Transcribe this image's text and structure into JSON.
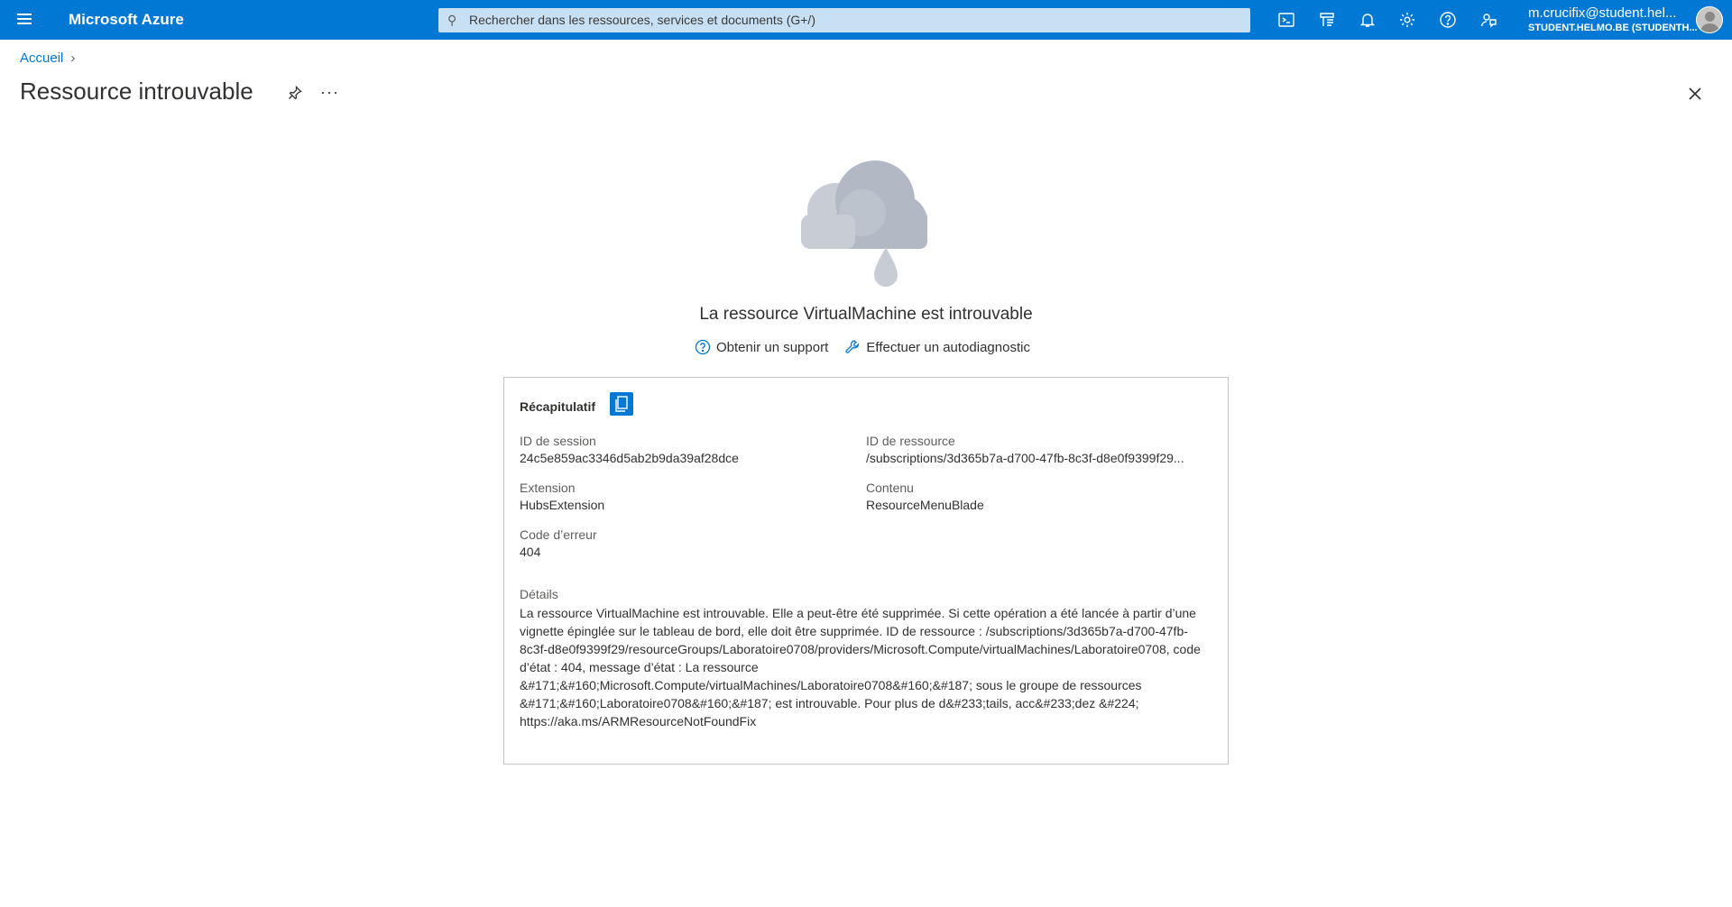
{
  "topbar": {
    "brand": "Microsoft Azure",
    "search_placeholder": "Rechercher dans les ressources, services et documents (G+/)",
    "account_name": "m.crucifix@student.hel...",
    "account_tenant": "STUDENT.HELMO.BE (STUDENTH...",
    "icons": [
      "cloud-shell-icon",
      "directory-filter-icon",
      "notifications-icon",
      "settings-icon",
      "help-icon",
      "feedback-icon"
    ]
  },
  "breadcrumb": {
    "home": "Accueil"
  },
  "page": {
    "title": "Ressource introuvable"
  },
  "error": {
    "title": "La ressource VirtualMachine est introuvable",
    "support_link": "Obtenir un support",
    "diagnose_link": "Effectuer un autodiagnostic"
  },
  "summary": {
    "heading": "Récapitulatif",
    "session_label": "ID de session",
    "session_value": "24c5e859ac3346d5ab2b9da39af28dce",
    "resource_label": "ID de ressource",
    "resource_value": "/subscriptions/3d365b7a-d700-47fb-8c3f-d8e0f9399f29...",
    "extension_label": "Extension",
    "extension_value": "HubsExtension",
    "content_label": "Contenu",
    "content_value": "ResourceMenuBlade",
    "code_label": "Code d’erreur",
    "code_value": "404",
    "details_label": "Détails",
    "details_value": "La ressource VirtualMachine est introuvable. Elle a peut-être été supprimée. Si cette opération a été lancée à partir d’une vignette épinglée sur le tableau de bord, elle doit être supprimée. ID de ressource : /subscriptions/3d365b7a-d700-47fb-8c3f-d8e0f9399f29/resourceGroups/Laboratoire0708/providers/Microsoft.Compute/virtualMachines/Laboratoire0708, code d’état : 404, message d’état : La ressource &#171;&#160;Microsoft.Compute/virtualMachines/Laboratoire0708&#160;&#187; sous le groupe de ressources &#171;&#160;Laboratoire0708&#160;&#187; est introuvable. Pour plus de d&#233;tails, acc&#233;dez &#224; https://aka.ms/ARMResourceNotFoundFix"
  },
  "colors": {
    "accent": "#0078d4",
    "search_bg": "#c7e0f4",
    "cloud": "#b3b9c4"
  }
}
